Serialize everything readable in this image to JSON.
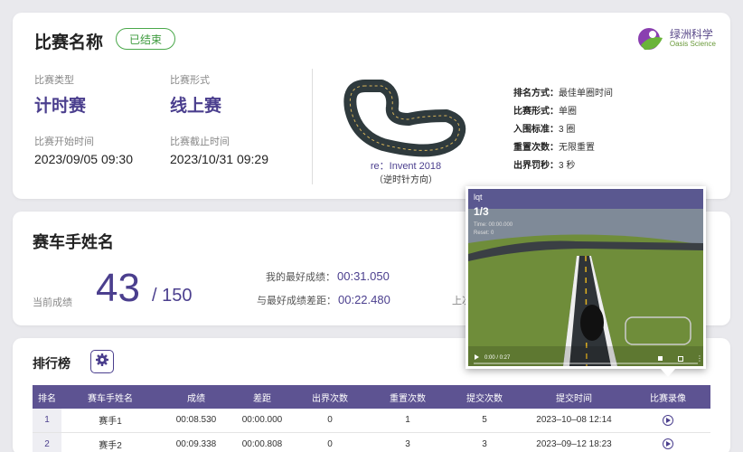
{
  "race": {
    "title": "比赛名称",
    "status": "已结束",
    "type_label": "比赛类型",
    "type_value": "计时赛",
    "format_label": "比赛形式",
    "format_value": "线上赛",
    "start_label": "比赛开始时间",
    "start_value": "2023/09/05 09:30",
    "end_label": "比赛截止时间",
    "end_value": "2023/10/31 09:29",
    "track_name": "re：Invent 2018",
    "track_direction": "（逆时针方向）",
    "rules": [
      {
        "k": "排名方式：",
        "v": "最佳单圈时间"
      },
      {
        "k": "比赛形式：",
        "v": "单圈"
      },
      {
        "k": "入围标准：",
        "v": "3 圈"
      },
      {
        "k": "重置次数：",
        "v": "无限重置"
      },
      {
        "k": "出界罚秒：",
        "v": "3 秒"
      }
    ]
  },
  "logo": {
    "cn": "绿洲科学",
    "en": "Oasis Science",
    "colors": [
      "#8a3fb0",
      "#6ab43a",
      "#4b3f8e"
    ]
  },
  "driver": {
    "name": "赛车手姓名",
    "current_label": "当前成绩",
    "current_rank": "43",
    "total": "/ 150",
    "best_label": "我的最好成绩：",
    "best_value": "00:31.050",
    "gap_label": "与最好成绩差距：",
    "gap_value": "00:22.480",
    "truncated_label": "上次"
  },
  "leaderboard": {
    "title": "排行榜",
    "columns": [
      "排名",
      "赛车手姓名",
      "成绩",
      "差距",
      "出界次数",
      "重置次数",
      "提交次数",
      "提交时间",
      "比赛录像"
    ],
    "rows": [
      [
        "1",
        "赛手1",
        "00:08.530",
        "00:00.000",
        "0",
        "1",
        "5",
        "2023–10–08 12:14"
      ],
      [
        "2",
        "赛手2",
        "00:09.338",
        "00:00.808",
        "0",
        "3",
        "3",
        "2023–09–12 18:23"
      ]
    ]
  },
  "video": {
    "user": "lqt",
    "lap": "1/3",
    "meta1": "Time: 00:00.000",
    "meta2": "Reset: 0",
    "time": "0:00 / 0:27"
  },
  "colors": {
    "accent": "#4b3f8e",
    "header": "#5d5392",
    "status_green": "#3c9a3c"
  }
}
